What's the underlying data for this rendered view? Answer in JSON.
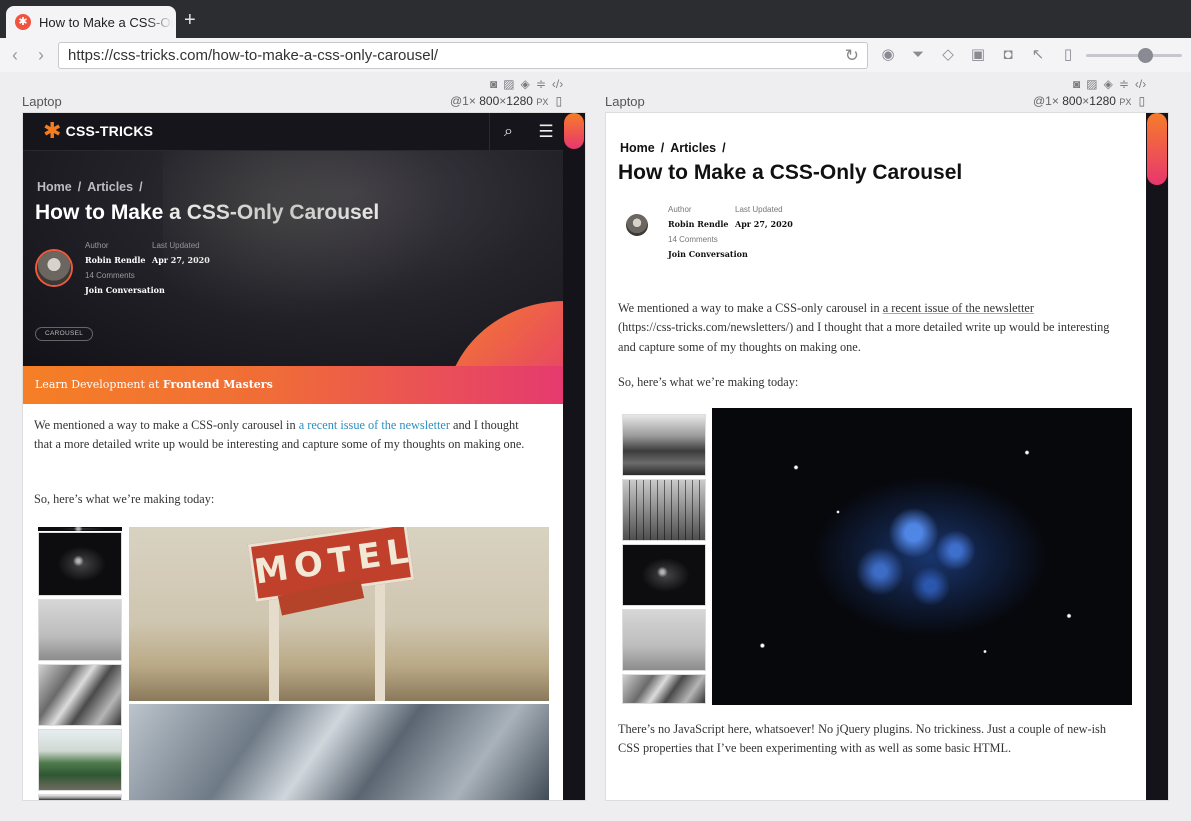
{
  "browser": {
    "tab_title": "How to Make a CSS-Only Carousel",
    "new_tab_icon": "+",
    "url": "https://css-tricks.com/how-to-make-a-css-only-carousel/"
  },
  "devices": [
    {
      "label": "Laptop",
      "scale": "@1×",
      "width": "800",
      "times": "×",
      "height": "1280",
      "unit": "PX"
    },
    {
      "label": "Laptop",
      "scale": "@1×",
      "width": "800",
      "times": "×",
      "height": "1280",
      "unit": "PX"
    }
  ],
  "site": {
    "logo": "CSS-TRICKS",
    "breadcrumbs": [
      "Home",
      "Articles"
    ],
    "breadcrumb_sep": "/",
    "title": "How to Make a CSS-Only Carousel",
    "author_label": "Author",
    "author": "Robin Rendle",
    "updated_label": "Last Updated",
    "updated": "Apr 27, 2020",
    "comments": "14 Comments",
    "join": "Join Conversation",
    "tag": "CAROUSEL",
    "promo_prefix": "Learn Development at ",
    "promo_link": "Frontend Masters",
    "p1_a": "We mentioned a way to make a CSS-only carousel in ",
    "p1_link": "a recent issue of the newsletter",
    "p1_b": " and I thought that a more detailed write up would be interesting and capture some of my thoughts on making one.",
    "p1_link_url": "(https://css-tricks.com/newsletters/)",
    "p1_b_right": " and I thought that a more detailed write up would be interesting and capture some of my thoughts on making one.",
    "p2": "So, here’s what we’re making today:",
    "p3": "There’s no JavaScript here, whatsoever! No jQuery plugins. No trickiness. Just a couple of new-ish CSS properties that I’ve been experimenting with as well as some basic HTML.",
    "motel_text": "MOTEL"
  },
  "colors": {
    "accent_orange": "#f57c1f",
    "accent_pink": "#e53a6f",
    "link_blue": "#2e8fc0",
    "dark_bg": "#16151b"
  }
}
